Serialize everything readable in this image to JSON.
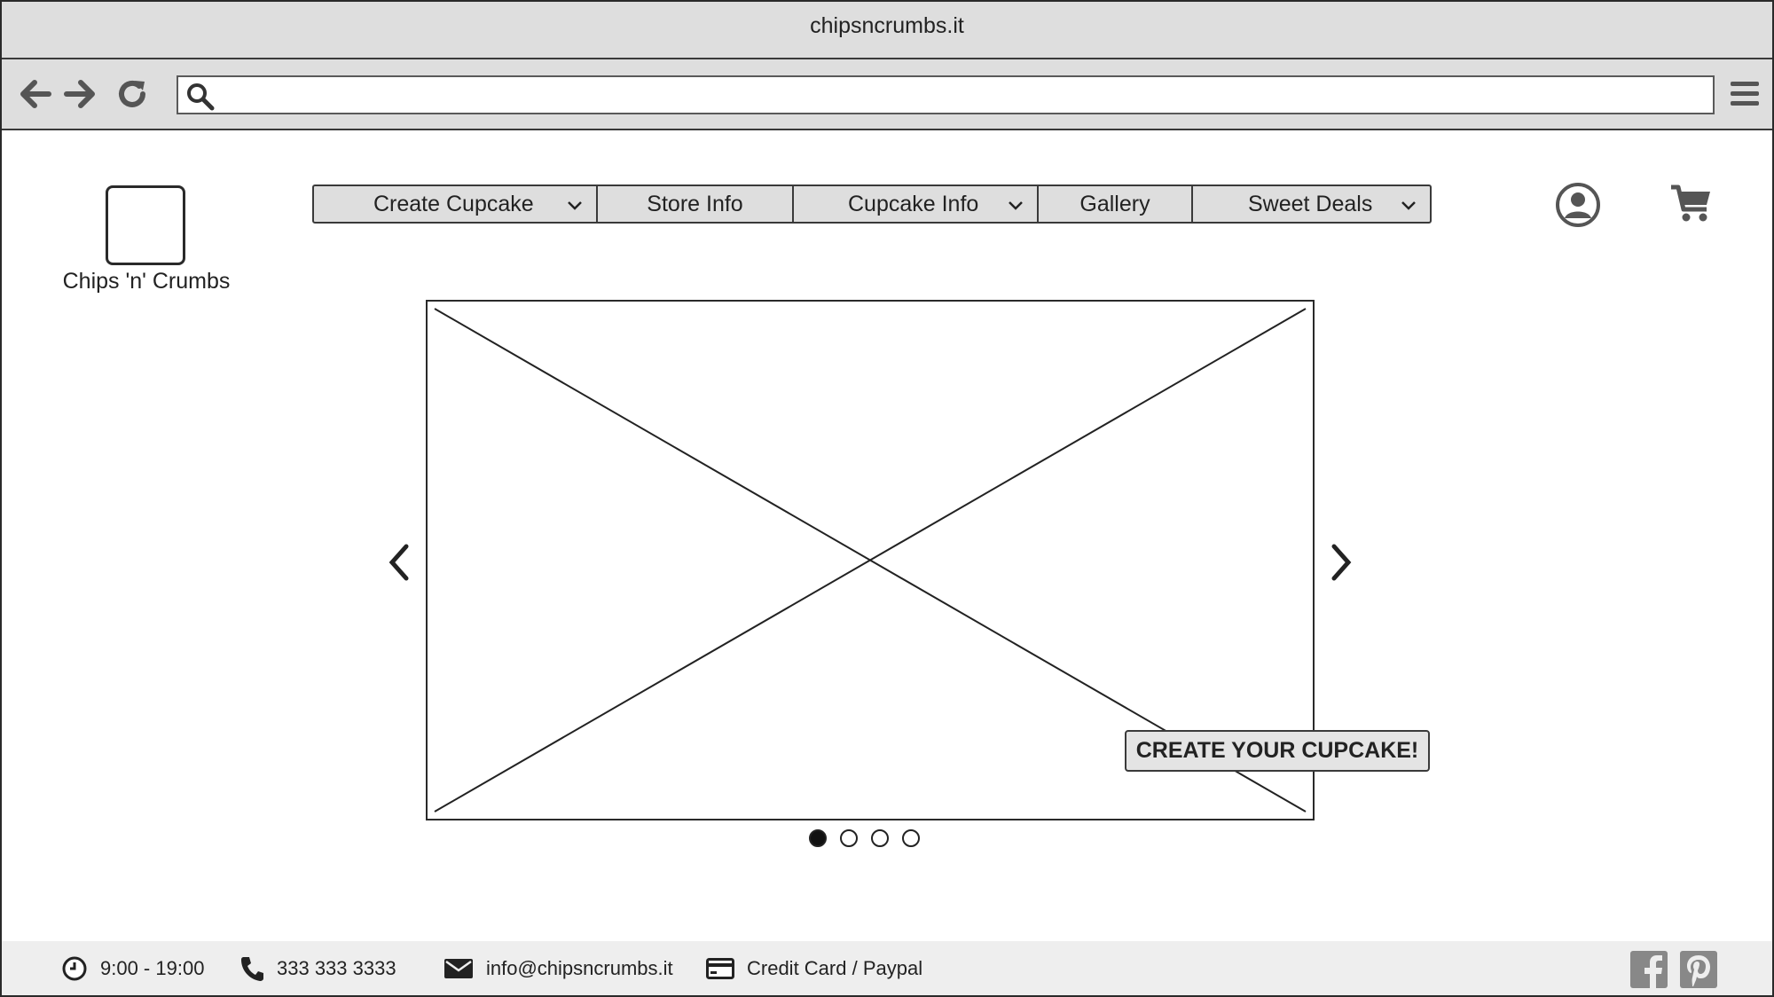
{
  "browser": {
    "title": "chipsncrumbs.it",
    "url_value": "",
    "icons": [
      "back-arrow-icon",
      "forward-arrow-icon",
      "reload-icon",
      "search-icon",
      "hamburger-menu-icon"
    ]
  },
  "brand": {
    "name": "Chips 'n' Crumbs"
  },
  "nav": {
    "items": [
      {
        "label": "Create Cupcake",
        "dropdown": true
      },
      {
        "label": "Store Info",
        "dropdown": false
      },
      {
        "label": "Cupcake Info",
        "dropdown": true
      },
      {
        "label": "Gallery",
        "dropdown": false
      },
      {
        "label": "Sweet Deals",
        "dropdown": true
      }
    ]
  },
  "header_icons": [
    "account-icon",
    "cart-icon"
  ],
  "carousel": {
    "cta_label": "CREATE YOUR CUPCAKE!",
    "slide_count": 4,
    "active_index": 0
  },
  "footer": {
    "hours": "9:00 - 19:00",
    "phone": "333 333 3333",
    "email": "info@chipsncrumbs.it",
    "payment": "Credit Card / Paypal",
    "social": [
      "facebook-icon",
      "pinterest-icon"
    ]
  },
  "colors": {
    "chrome_bg": "#dedede",
    "border": "#2a2a2a",
    "footer_bg": "#eeeeee",
    "text": "#222222"
  }
}
